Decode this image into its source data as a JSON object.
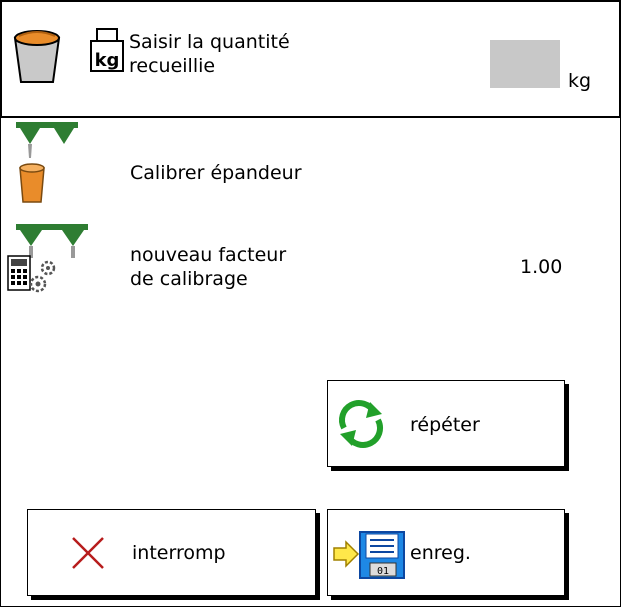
{
  "header": {
    "title_line1": "Saisir la quantité",
    "title_line2": "recueillie",
    "input_value": "",
    "unit": "kg",
    "scale_icon_text": "kg"
  },
  "rows": [
    {
      "label_line1": "Calibrer épandeur",
      "label_line2": "",
      "value": ""
    },
    {
      "label_line1": "nouveau facteur",
      "label_line2": "de calibrage",
      "value": "1.00"
    }
  ],
  "buttons": {
    "repeat": "répéter",
    "abort": "interromp",
    "save": "enreg.",
    "save_icon_text": "01"
  },
  "colors": {
    "spreader_green": "#2e7d32",
    "bucket_orange": "#e98c2a",
    "refresh_green": "#22a02a",
    "cancel_red": "#b71c1c",
    "disk_blue": "#1e88e5"
  }
}
